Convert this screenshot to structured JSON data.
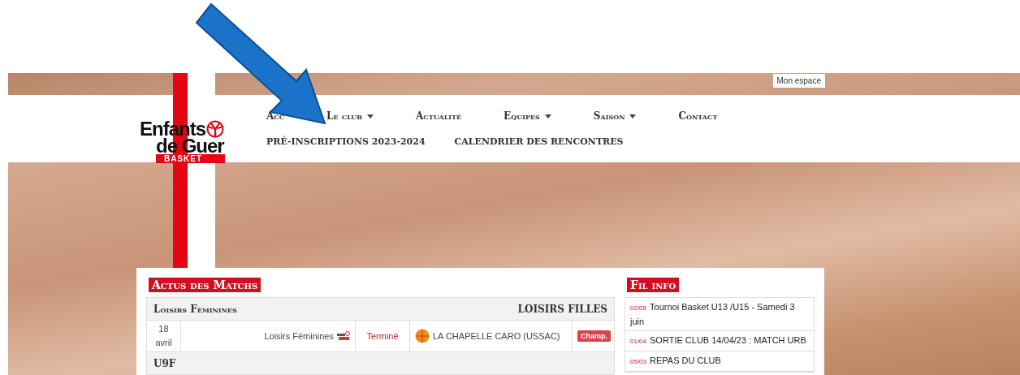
{
  "account_button": "Mon espace",
  "logo": {
    "line_1": "Enfants",
    "line_2": "de Guer",
    "tagline": "BASKET"
  },
  "nav": {
    "primary": [
      {
        "label": "Acc",
        "dropdown": false
      },
      {
        "label": "Le club",
        "dropdown": true
      },
      {
        "label": "Actualité",
        "dropdown": false
      },
      {
        "label": "Equipes",
        "dropdown": true
      },
      {
        "label": "Saison",
        "dropdown": true
      },
      {
        "label": "Contact",
        "dropdown": false
      }
    ],
    "secondary": [
      {
        "label": "PRÉ-INSCRIPTIONS 2023-2024"
      },
      {
        "label": "CALENDRIER DES RENCONTRES"
      }
    ]
  },
  "matches": {
    "title": "Actus des Matchs",
    "groups": [
      {
        "name": "Loisirs Féminines",
        "category": "LOISIRS FILLES",
        "rows": [
          {
            "day": "18",
            "month": "avril",
            "team": "Loisirs Féminines",
            "status": "Terminé",
            "opponent": "LA CHAPELLE CARO (USSAC)",
            "badge": "Champ."
          }
        ]
      },
      {
        "name": "U9F"
      }
    ]
  },
  "news": {
    "title": "Fil info",
    "items": [
      {
        "date": "02/05",
        "text": "Tournoi Basket U13 /U15 - Samedi 3 juin"
      },
      {
        "date": "01/04",
        "text": "SORTIE CLUB 14/04/23 : MATCH URB"
      },
      {
        "date": "05/03",
        "text": "REPAS DU CLUB"
      }
    ]
  }
}
